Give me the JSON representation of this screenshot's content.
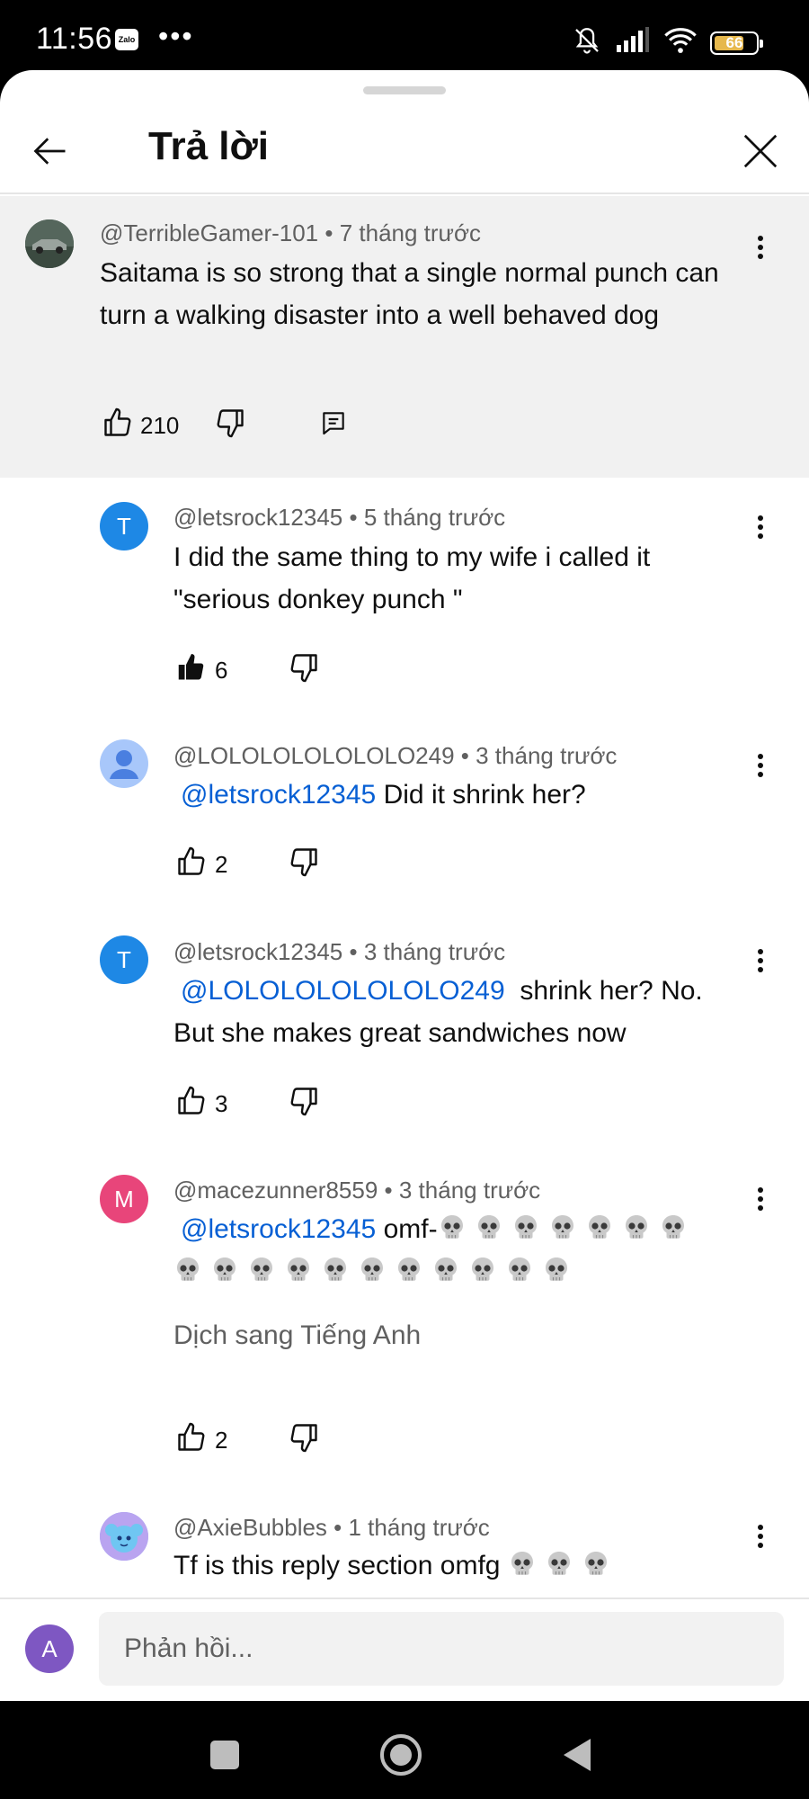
{
  "status_bar": {
    "time": "11:56",
    "notification_app": "Zalo",
    "overflow": "•••",
    "battery_level": "66",
    "icons": [
      "bell-off-icon",
      "signal-icon",
      "wifi-icon",
      "battery-icon"
    ]
  },
  "header": {
    "title": "Trả lời",
    "back_icon": "arrow-left-icon",
    "close_icon": "close-icon"
  },
  "parent_comment": {
    "author": "@TerribleGamer-101",
    "time": "7 tháng trước",
    "text": "Saitama is so strong that a single normal punch can turn a walking disaster into a well behaved dog",
    "likes": "210"
  },
  "replies": [
    {
      "author": "@letsrock12345",
      "time": "5 tháng trước",
      "avatar_letter": "T",
      "avatar_color": "#1e88e5",
      "text": "I did the same thing to my wife i called it \"serious donkey punch \"",
      "likes": "6",
      "liked": true
    },
    {
      "author": "@LOLOLOLOLOLOLO249",
      "time": "3 tháng trước",
      "avatar_color": "#a8c7fa",
      "mention": "@letsrock12345",
      "text": "Did it shrink her?",
      "likes": "2"
    },
    {
      "author": "@letsrock12345",
      "time": "3 tháng trước",
      "avatar_letter": "T",
      "avatar_color": "#1e88e5",
      "mention": "@LOLOLOLOLOLOLO249",
      "text": "shrink her? No. But she makes great sandwiches now",
      "likes": "3"
    },
    {
      "author": "@macezunner8559",
      "time": "3 tháng trước",
      "avatar_letter": "M",
      "avatar_color": "#e8457a",
      "mention": "@letsrock12345",
      "text": "omf-",
      "emoji": "💀",
      "translate_label": "Dịch sang Tiếng Anh",
      "likes": "2"
    },
    {
      "author": "@AxieBubbles",
      "time": "1 tháng trước",
      "avatar_color": "#5b8def",
      "text": "Tf is this reply section omfg",
      "likes": ""
    }
  ],
  "composer": {
    "avatar_letter": "A",
    "placeholder": "Phản hồi..."
  },
  "nav_bar": {
    "buttons": [
      "recents-square-icon",
      "home-circle-icon",
      "back-triangle-icon"
    ]
  },
  "colors": {
    "mention": "#065fd4",
    "parent_bg": "#f1f1f1",
    "meta_text": "#606060",
    "composer_avatar": "#7e57c2"
  }
}
